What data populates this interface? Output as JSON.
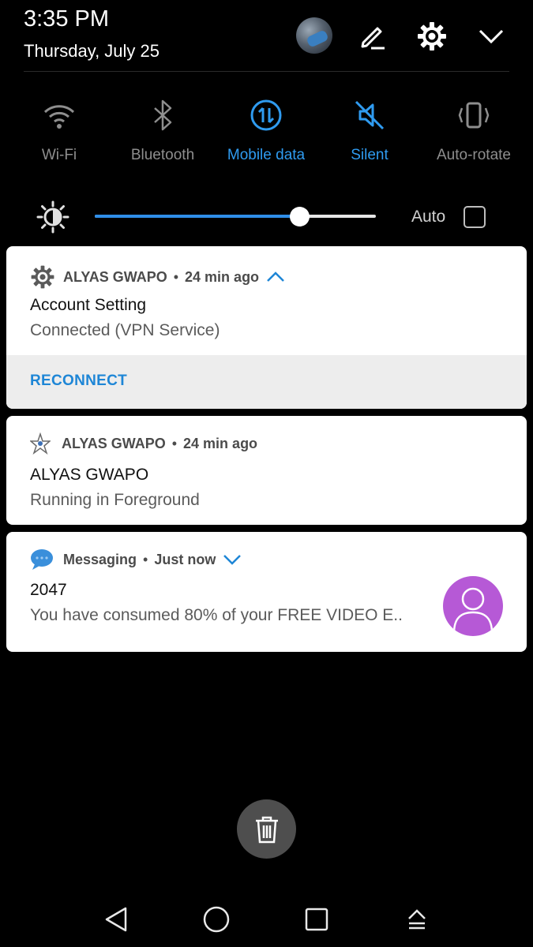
{
  "status": {
    "time": "3:35 PM",
    "date": "Thursday, July 25"
  },
  "header_icons": [
    "avatar",
    "edit-icon",
    "settings-icon",
    "chevron-down-icon"
  ],
  "quick_settings": [
    {
      "label": "Wi-Fi",
      "icon": "wifi-icon",
      "active": false
    },
    {
      "label": "Bluetooth",
      "icon": "bluetooth-icon",
      "active": false
    },
    {
      "label": "Mobile data",
      "icon": "mobile-data-icon",
      "active": true
    },
    {
      "label": "Silent",
      "icon": "silent-icon",
      "active": true
    },
    {
      "label": "Auto-rotate",
      "icon": "auto-rotate-icon",
      "active": false
    }
  ],
  "brightness": {
    "level": 0.73,
    "auto_label": "Auto",
    "auto_checked": false
  },
  "notifications": [
    {
      "app": "ALYAS GWAPO",
      "time": "24 min ago",
      "title": "Account Setting",
      "body": "Connected (VPN Service)",
      "action": "RECONNECT",
      "icon": "gear-icon"
    },
    {
      "app": "ALYAS GWAPO",
      "time": "24 min ago",
      "title": "ALYAS GWAPO",
      "body": "Running in Foreground",
      "icon": "app-logo-icon"
    },
    {
      "app": "Messaging",
      "time": "Just now",
      "title": "2047",
      "body": "You have consumed 80% of your FREE VIDEO E..",
      "icon": "message-bubble-icon"
    }
  ],
  "colors": {
    "accent": "#2f9bf0",
    "background": "#000000",
    "card": "#ffffff",
    "avatar": "#b659d6"
  }
}
